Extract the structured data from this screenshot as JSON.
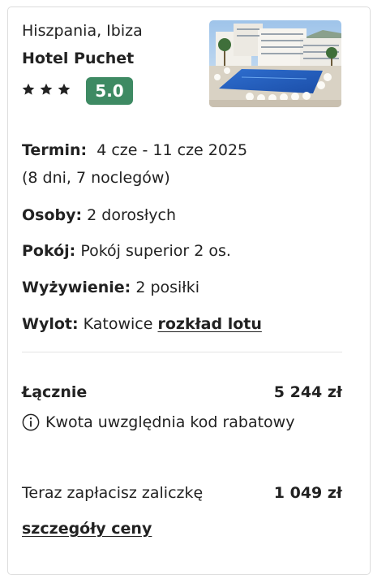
{
  "hotel": {
    "location": "Hiszpania, Ibiza",
    "name": "Hotel Puchet",
    "stars": 3,
    "rating": "5.0",
    "photo_alt_icon": "hotel-photo"
  },
  "details": {
    "term_label": "Termin:",
    "term_value": "4 cze - 11 cze 2025",
    "term_sub": "(8 dni, 7 noclegów)",
    "persons_label": "Osoby:",
    "persons_value": "2 dorosłych",
    "room_label": "Pokój:",
    "room_value": "Pokój superior 2 os.",
    "board_label": "Wyżywienie:",
    "board_value": "2 posiłki",
    "flight_label": "Wylot:",
    "flight_value": "Katowice",
    "flight_link": "rozkład lotu"
  },
  "price": {
    "total_label": "Łącznie",
    "total_value": "5 244 zł",
    "discount_note": "Kwota uwzględnia kod rabatowy",
    "deposit_label": "Teraz zapłacisz zaliczkę",
    "deposit_value": "1 049 zł",
    "details_link": "szczegóły ceny"
  },
  "colors": {
    "rating_badge": "#3e8a63",
    "text": "#222222",
    "border": "#dcdcdc"
  }
}
